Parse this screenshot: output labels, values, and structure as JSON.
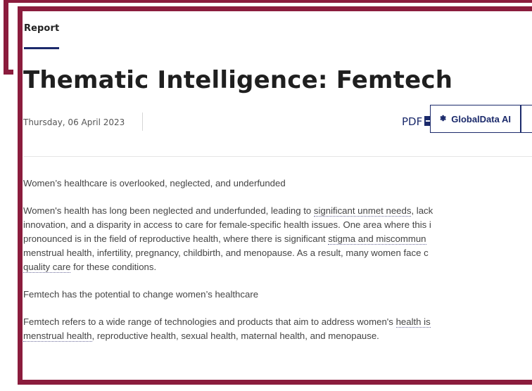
{
  "eyebrow": "Report",
  "title": "Thematic Intelligence: Femtech",
  "date": "Thursday, 06 April 2023",
  "pdf_label": "PDF",
  "ai_button_label": "GlobalData AI",
  "paragraphs": {
    "p1": "Women’s healthcare is overlooked, neglected, and underfunded",
    "p2_l1_a": "Women's health has long been neglected and underfunded, leading to ",
    "p2_l1_link": "significant unmet needs",
    "p2_l1_b": ", lack",
    "p2_l2": "innovation, and a disparity in access to care for female-specific health issues. One area where this i",
    "p2_l3_a": "pronounced is in the field of reproductive health, where there is significant ",
    "p2_l3_link": "stigma and miscommun",
    "p2_l4": "menstrual health, infertility, pregnancy, childbirth, and menopause. As a result, many women face c",
    "p2_l5_link": "quality care",
    "p2_l5_b": " for these conditions.",
    "p3": "Femtech has the potential to change women’s healthcare",
    "p4_l1_a": "Femtech refers to a wide range of technologies and products that aim to address women's ",
    "p4_l1_link": "health is",
    "p4_l2_link": "menstrual health",
    "p4_l2_b": ", reproductive health, sexual health, maternal health, and menopause."
  },
  "colors": {
    "frame": "#8b1c3d",
    "accent": "#1b2a6b"
  }
}
